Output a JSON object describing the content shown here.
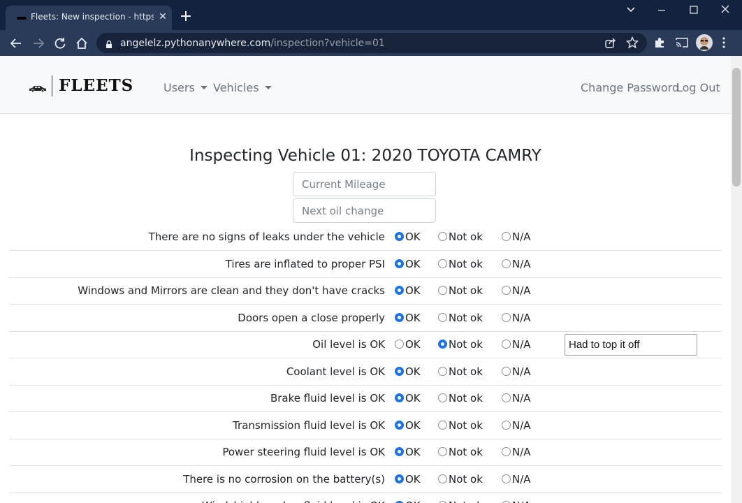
{
  "browser": {
    "tab_title": "Fleets: New inspection - https://a",
    "url_host": "angelelz.pythonanywhere.com",
    "url_path": "/inspection?vehicle=01"
  },
  "navbar": {
    "brand": "FLEETS",
    "users": "Users",
    "vehicles": "Vehicles",
    "change_password": "Change Password",
    "logout": "Log Out"
  },
  "heading": "Inspecting Vehicle 01: 2020 TOYOTA CAMRY",
  "fields": {
    "mileage_placeholder": "Current Mileage",
    "oil_placeholder": "Next oil change"
  },
  "options": {
    "ok": "OK",
    "not_ok": "Not ok",
    "na": "N/A"
  },
  "items": [
    {
      "label": "There are no signs of leaks under the vehicle",
      "selected": "ok"
    },
    {
      "label": "Tires are inflated to proper PSI",
      "selected": "ok"
    },
    {
      "label": "Windows and Mirrors are clean and they don't have cracks",
      "selected": "ok"
    },
    {
      "label": "Doors open a close properly",
      "selected": "ok"
    },
    {
      "label": "Oil level is OK",
      "selected": "not_ok",
      "note": "Had to top it off"
    },
    {
      "label": "Coolant level is OK",
      "selected": "ok"
    },
    {
      "label": "Brake fluid level is OK",
      "selected": "ok"
    },
    {
      "label": "Transmission fluid level is OK",
      "selected": "ok"
    },
    {
      "label": "Power steering fluid level is OK",
      "selected": "ok"
    },
    {
      "label": "There is no corrosion on the battery(s)",
      "selected": "ok"
    },
    {
      "label": "Windshield washer fluid level is OK",
      "selected": "ok"
    }
  ],
  "colors": {
    "accent": "#1a73e8",
    "chrome_dark": "#13233f",
    "chrome_toolbar": "#2a3b5a"
  }
}
